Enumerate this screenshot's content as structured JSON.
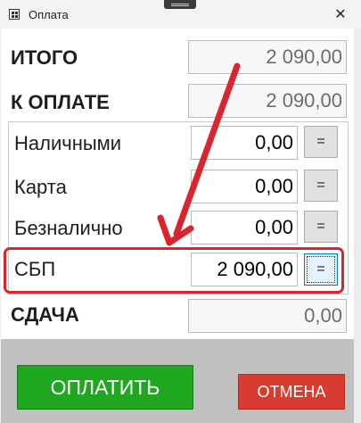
{
  "window": {
    "title": "Оплата",
    "close_glyph": "✕"
  },
  "rows": {
    "total": {
      "label": "ИТОГО",
      "value": "2 090,00"
    },
    "to_pay": {
      "label": "К ОПЛАТЕ",
      "value": "2 090,00"
    },
    "cash": {
      "label": "Наличными",
      "value": "0,00",
      "eq": "="
    },
    "card": {
      "label": "Карта",
      "value": "0,00",
      "eq": "="
    },
    "cashless": {
      "label": "Безналично",
      "value": "0,00",
      "eq": "="
    },
    "sbp": {
      "label": "СБП",
      "value": "2 090,00",
      "eq": "="
    },
    "change": {
      "label": "СДАЧА",
      "value": "0,00"
    }
  },
  "buttons": {
    "pay": "ОПЛАТИТЬ",
    "cancel": "ОТМЕНА"
  },
  "colors": {
    "pay_button": "#1fa71f",
    "cancel_button": "#d93b31",
    "annotation": "#d9262e"
  },
  "icons": {
    "app": "window-grid-icon",
    "close": "close-icon",
    "annotation": "red-arrow-icon"
  }
}
